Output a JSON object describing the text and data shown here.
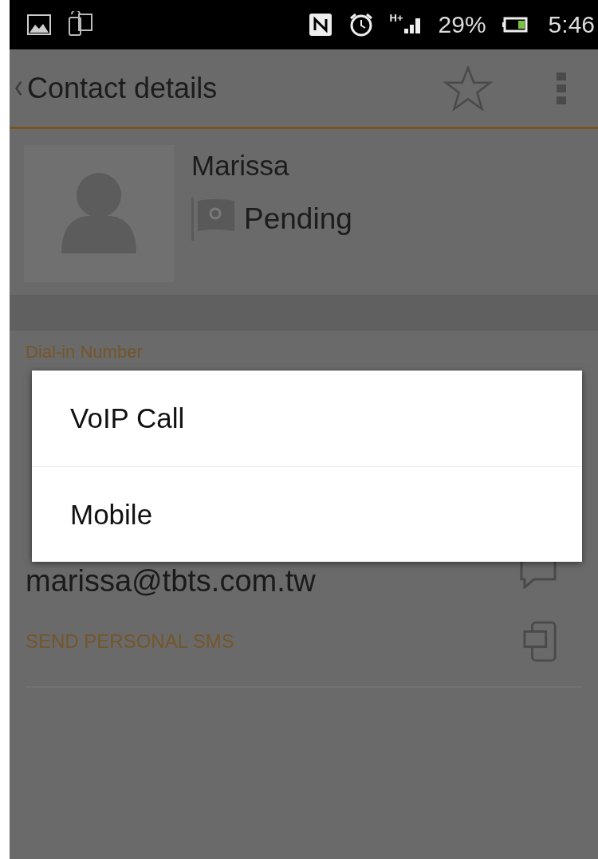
{
  "status_bar": {
    "network": "H+",
    "battery": "29%",
    "time": "5:46"
  },
  "action_bar": {
    "title": "Contact details",
    "starred": false
  },
  "contact": {
    "name": "Marissa",
    "status": "Pending"
  },
  "details": {
    "dial_in_label": "Dial-in Number",
    "email": "marissa@tbts.com.tw",
    "sms_action": "SEND PERSONAL SMS"
  },
  "dialog": {
    "options": [
      {
        "label": "VoIP Call"
      },
      {
        "label": "Mobile"
      }
    ]
  }
}
